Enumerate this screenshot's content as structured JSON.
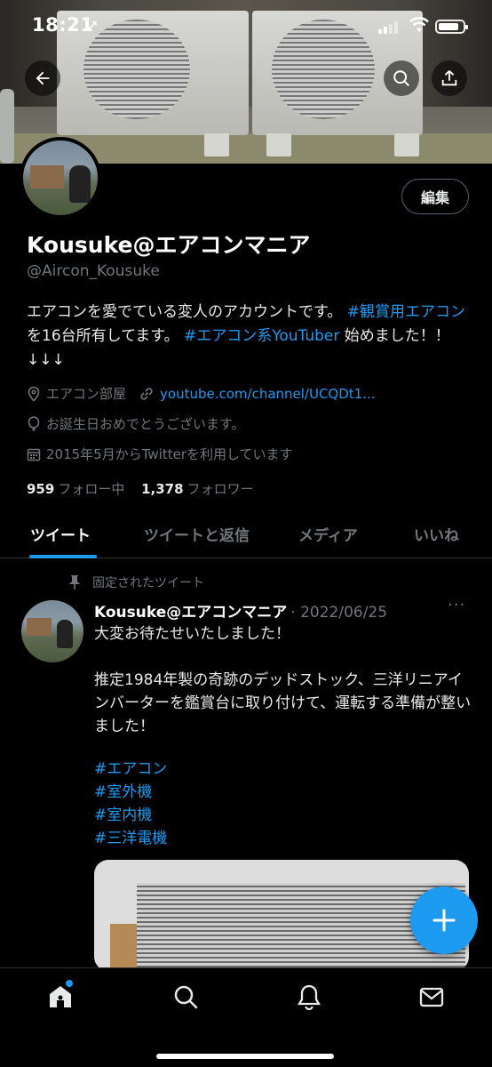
{
  "status_bar": {
    "time": "18:21",
    "location_arrow": "➚"
  },
  "header": {
    "back_icon": "arrow-left-icon",
    "search_icon": "search-icon",
    "share_icon": "share-icon"
  },
  "profile": {
    "edit_label": "編集",
    "display_name": "Kousuke@エアコンマニア",
    "handle": "@Aircon_Kousuke",
    "bio": {
      "t1": "エアコンを愛でている変人のアカウントです。",
      "h1": "#観賞用エアコン",
      "t2": "を16台所有してます。",
      "h2": "#エアコン系YouTuber",
      "t3": "始めました！！↓↓↓"
    },
    "location": "エアコン部屋",
    "website": "youtube.com/channel/UCQDt1...",
    "birthday": "お誕生日おめでとうございます。",
    "joined": "2015年5月からTwitterを利用しています",
    "following_count": "959",
    "following_label": "フォロー中",
    "followers_count": "1,378",
    "followers_label": "フォロワー"
  },
  "tabs": [
    {
      "label": "ツイート"
    },
    {
      "label": "ツイートと返信"
    },
    {
      "label": "メディア"
    },
    {
      "label": "いいね"
    }
  ],
  "pinned_tweet": {
    "pinned_label": "固定されたツイート",
    "author": "Kousuke@エアコンマニア",
    "date": "· 2022/06/25",
    "more": "···",
    "para1": "大変お待たせいたしました！",
    "para2": "推定1984年製の奇跡のデッドストック、三洋リニアインバーターを鑑賞台に取り付けて、運転する準備が整いました！",
    "hashtags": [
      "#エアコン",
      "#室外機",
      "#室内機",
      "#三洋電機"
    ]
  },
  "colors": {
    "accent": "#1d9bf0",
    "background": "#000000",
    "secondary_text": "#71767b"
  },
  "bottom_nav": {
    "icons": [
      "home-icon",
      "search-icon",
      "bell-icon",
      "mail-icon"
    ]
  }
}
